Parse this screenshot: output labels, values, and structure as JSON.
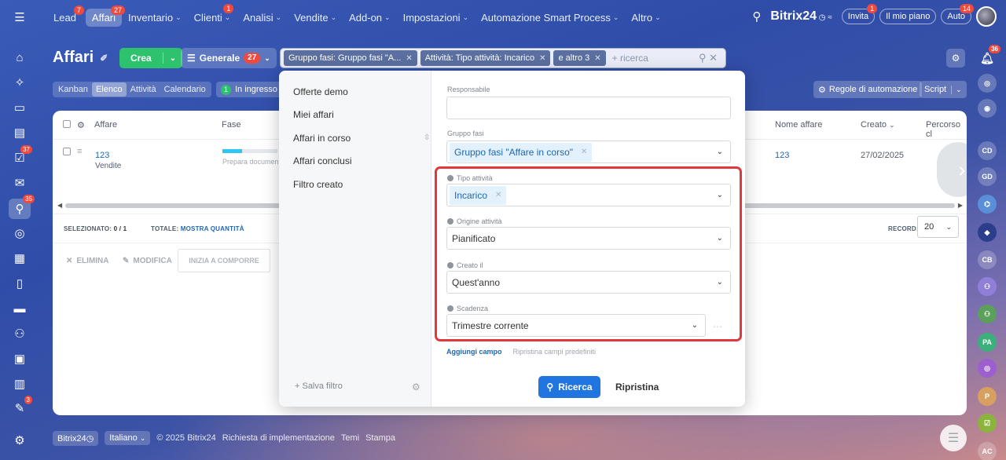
{
  "topnav": {
    "items": [
      {
        "label": "Lead",
        "badge": "7",
        "chevron": false,
        "active": false
      },
      {
        "label": "Affari",
        "badge": "27",
        "chevron": false,
        "active": true
      },
      {
        "label": "Inventario",
        "badge": "",
        "chevron": true,
        "active": false
      },
      {
        "label": "Clienti",
        "badge": "1",
        "chevron": true,
        "active": false
      },
      {
        "label": "Analisi",
        "badge": "",
        "chevron": true,
        "active": false
      },
      {
        "label": "Vendite",
        "badge": "",
        "chevron": true,
        "active": false
      },
      {
        "label": "Add-on",
        "badge": "",
        "chevron": true,
        "active": false
      },
      {
        "label": "Impostazioni",
        "badge": "",
        "chevron": true,
        "active": false
      },
      {
        "label": "Automazione Smart Process",
        "badge": "",
        "chevron": true,
        "active": false
      },
      {
        "label": "Altro",
        "badge": "",
        "chevron": true,
        "active": false
      }
    ],
    "logo": "Bitrix24",
    "invita": "Invita",
    "invita_badge": "1",
    "mio_piano": "Il mio piano",
    "auto": "Auto",
    "auto_badge": "14"
  },
  "header": {
    "title": "Affari",
    "crea": "Crea",
    "preset": "Generale",
    "preset_badge": "27",
    "chips": [
      "Gruppo fasi: Gruppo fasi \"A...",
      "Attività: Tipo attività: Incarico",
      "e altro 3"
    ],
    "search_placeholder": "+ ricerca"
  },
  "views": {
    "tabs": [
      "Kanban",
      "Elenco",
      "Attività",
      "Calendario"
    ],
    "active": "Elenco",
    "ingresso_count": "1",
    "ingresso": "In ingresso",
    "regole": "Regole di automazione",
    "script": "Script"
  },
  "grid": {
    "col_affare": "Affare",
    "col_fase": "Fase",
    "col_nome": "Nome affare",
    "col_creato": "Creato",
    "col_percorso": "Percorso cl",
    "row": {
      "affare": "123",
      "affare_sub": "Vendite",
      "fase": "Prepara documen",
      "nome": "123",
      "creato": "27/02/2025",
      "progress": 0.36
    },
    "selezionato_label": "SELEZIONATO:",
    "selezionato_value": "0 / 1",
    "totale_label": "TOTALE:",
    "totale_value": "MOSTRA QUANTITÀ",
    "record_label": "RECORD:",
    "record_value": "20",
    "elimina": "ELIMINA",
    "modifica": "MODIFICA",
    "inizia": "INIZIA A COMPORRE"
  },
  "popup": {
    "presets": [
      "Offerte demo",
      "Miei affari",
      "Affari in corso",
      "Affari conclusi",
      "Filtro creato"
    ],
    "salva": "+ Salva filtro",
    "fields": {
      "responsabile_label": "Responsabile",
      "gruppo_label": "Gruppo fasi",
      "gruppo_tag": "Gruppo fasi \"Affare in corso\"",
      "tipo_label": "Tipo attività",
      "tipo_tag": "Incarico",
      "origine_label": "Origine attività",
      "origine_value": "Pianificato",
      "creato_label": "Creato il",
      "creato_value": "Quest'anno",
      "scadenza_label": "Scadenza",
      "scadenza_value": "Trimestre corrente"
    },
    "aggiungi": "Aggiungi campo",
    "ripristina_campi": "Ripristina campi predefiniti",
    "ricerca": "Ricerca",
    "ripristina": "Ripristina"
  },
  "footer": {
    "brand": "Bitrix24",
    "lang": "Italiano",
    "copyright": "© 2025 Bitrix24",
    "richiesta": "Richiesta di implementazione",
    "temi": "Temi",
    "stampa": "Stampa"
  },
  "leftbar_badges": {
    "tasks": "37",
    "crm": "35",
    "bottom": "3"
  },
  "rightbar": {
    "notif_badge": "36",
    "avatars": [
      "CD",
      "GD",
      "",
      "",
      "CB",
      "",
      "",
      "PA",
      "",
      "P",
      "",
      "AC"
    ]
  },
  "colors": {
    "accent_green": "#2fc26e",
    "primary_blue": "#2075e0",
    "highlight_red": "#e0383d",
    "badge_red": "#f0493e"
  }
}
